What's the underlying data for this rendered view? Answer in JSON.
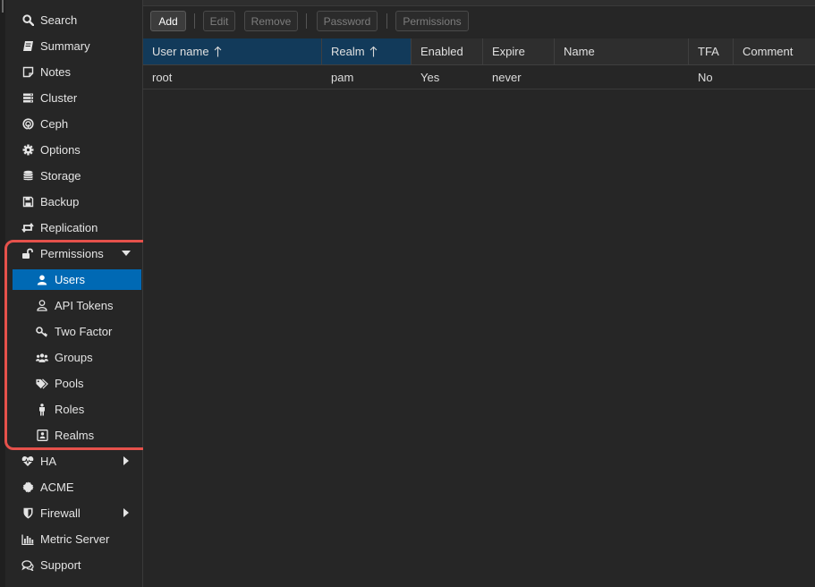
{
  "sidebar": {
    "items": [
      {
        "label": "Search",
        "icon": "search-icon"
      },
      {
        "label": "Summary",
        "icon": "book-icon"
      },
      {
        "label": "Notes",
        "icon": "note-icon"
      },
      {
        "label": "Cluster",
        "icon": "server-icon"
      },
      {
        "label": "Ceph",
        "icon": "ceph-icon"
      },
      {
        "label": "Options",
        "icon": "gear-icon"
      },
      {
        "label": "Storage",
        "icon": "database-icon"
      },
      {
        "label": "Backup",
        "icon": "floppy-icon"
      },
      {
        "label": "Replication",
        "icon": "retweet-icon"
      },
      {
        "label": "Permissions",
        "icon": "unlock-icon"
      },
      {
        "label": "Users",
        "icon": "user-icon"
      },
      {
        "label": "API Tokens",
        "icon": "user-outline-icon"
      },
      {
        "label": "Two Factor",
        "icon": "key-icon"
      },
      {
        "label": "Groups",
        "icon": "users-icon"
      },
      {
        "label": "Pools",
        "icon": "tags-icon"
      },
      {
        "label": "Roles",
        "icon": "male-icon"
      },
      {
        "label": "Realms",
        "icon": "address-book-icon"
      },
      {
        "label": "HA",
        "icon": "heartbeat-icon"
      },
      {
        "label": "ACME",
        "icon": "certificate-icon"
      },
      {
        "label": "Firewall",
        "icon": "shield-icon"
      },
      {
        "label": "Metric Server",
        "icon": "bar-chart-icon"
      },
      {
        "label": "Support",
        "icon": "comments-icon"
      }
    ]
  },
  "toolbar": {
    "add_label": "Add",
    "edit_label": "Edit",
    "remove_label": "Remove",
    "password_label": "Password",
    "permissions_label": "Permissions"
  },
  "grid": {
    "columns": [
      "User name",
      "Realm",
      "Enabled",
      "Expire",
      "Name",
      "TFA",
      "Comment"
    ],
    "rows": [
      {
        "username": "root",
        "realm": "pam",
        "enabled": "Yes",
        "expire": "never",
        "name": "",
        "tfa": "No",
        "comment": ""
      }
    ]
  },
  "colors": {
    "selected": "#0069b4",
    "highlight": "#e5514b",
    "sorted_header": "#123a5a"
  }
}
